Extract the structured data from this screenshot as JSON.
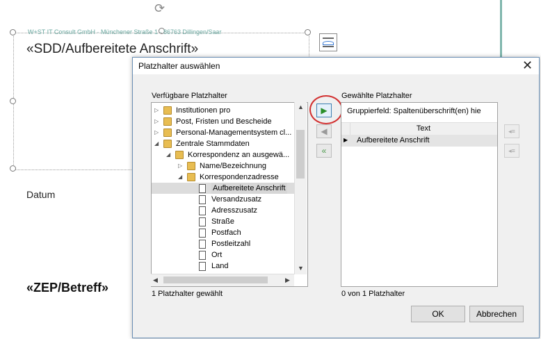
{
  "document": {
    "address_line": "W+ST IT Consult GmbH · Münchener Straße 1 · 86763 Dillingen/Saar",
    "field_title": "«SDD/Aufbereitete Anschrift»",
    "datum_label": "Datum",
    "betreff": "«ZEP/Betreff»"
  },
  "dialog": {
    "title": "Platzhalter auswählen",
    "close_label": "✕",
    "available": {
      "label": "Verfügbare Platzhalter",
      "items": [
        {
          "label": "Institutionen pro",
          "icon": "folder-icon",
          "expander": "▷"
        },
        {
          "label": "Post, Fristen und Bescheide",
          "icon": "folder-icon",
          "expander": "▷"
        },
        {
          "label": "Personal-Managementsystem cl...",
          "icon": "folder-icon",
          "expander": "▷"
        },
        {
          "label": "Zentrale Stammdaten",
          "icon": "folder-icon",
          "expander": "◢"
        },
        {
          "label": "Korrespondenz an ausgewä...",
          "icon": "folder-icon",
          "expander": "◢"
        },
        {
          "label": "Name/Bezeichnung",
          "icon": "folder-icon",
          "expander": "▷"
        },
        {
          "label": "Korrespondenzadresse",
          "icon": "folder-icon",
          "expander": "◢"
        },
        {
          "label": "Aufbereitete Anschrift",
          "icon": "document-icon",
          "expander": ""
        },
        {
          "label": "Versandzusatz",
          "icon": "document-icon",
          "expander": ""
        },
        {
          "label": "Adresszusatz",
          "icon": "document-icon",
          "expander": ""
        },
        {
          "label": "Straße",
          "icon": "document-icon",
          "expander": ""
        },
        {
          "label": "Postfach",
          "icon": "document-icon",
          "expander": ""
        },
        {
          "label": "Postleitzahl",
          "icon": "document-icon",
          "expander": ""
        },
        {
          "label": "Ort",
          "icon": "document-icon",
          "expander": ""
        },
        {
          "label": "Land",
          "icon": "document-icon",
          "expander": ""
        }
      ],
      "status": "1 Platzhalter gewählt"
    },
    "selected": {
      "label": "Gewählte Platzhalter",
      "group_field": "Gruppierfeld: Spaltenüberschrift(en) hie",
      "column_header": "Text",
      "rows": [
        "Aufbereitete Anschrift"
      ],
      "status": "0 von 1 Platzhalter"
    },
    "buttons": {
      "ok": "OK",
      "cancel": "Abbrechen"
    },
    "colors": {
      "accent_red": "#d23030",
      "teal": "#7fb6ad"
    }
  }
}
